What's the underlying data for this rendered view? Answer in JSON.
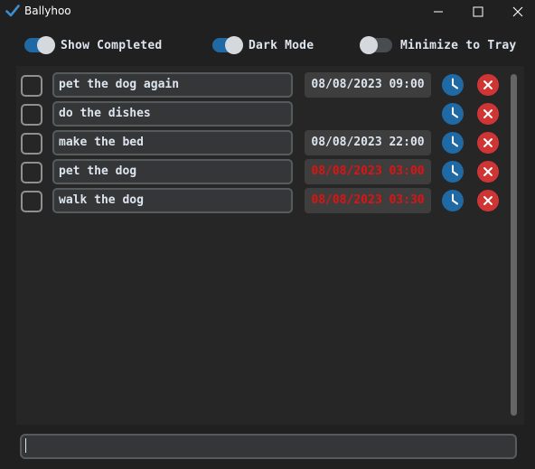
{
  "window": {
    "title": "Ballyhoo"
  },
  "toggles": [
    {
      "label": "Show Completed",
      "on": true
    },
    {
      "label": "Dark Mode",
      "on": true
    },
    {
      "label": "Minimize to Tray",
      "on": false
    }
  ],
  "tasks": [
    {
      "text": "pet the dog again",
      "due": "08/08/2023 09:00",
      "overdue": false,
      "completed": false
    },
    {
      "text": "do the dishes",
      "due": "",
      "overdue": false,
      "completed": false
    },
    {
      "text": "make the bed",
      "due": "08/08/2023 22:00",
      "overdue": false,
      "completed": false
    },
    {
      "text": "pet the dog",
      "due": "08/08/2023 03:00",
      "overdue": true,
      "completed": false
    },
    {
      "text": "walk the dog",
      "due": "08/08/2023 03:30",
      "overdue": true,
      "completed": false
    }
  ],
  "new_task": {
    "value": "",
    "placeholder": ""
  },
  "colors": {
    "accent": "#1f6aa5",
    "delete": "#d03535",
    "overdue": "#e01212",
    "background": "#202020",
    "panel": "#262626"
  },
  "icons": {
    "app": "checkmark-icon",
    "clock": "clock-icon",
    "delete": "close-circle-icon"
  }
}
